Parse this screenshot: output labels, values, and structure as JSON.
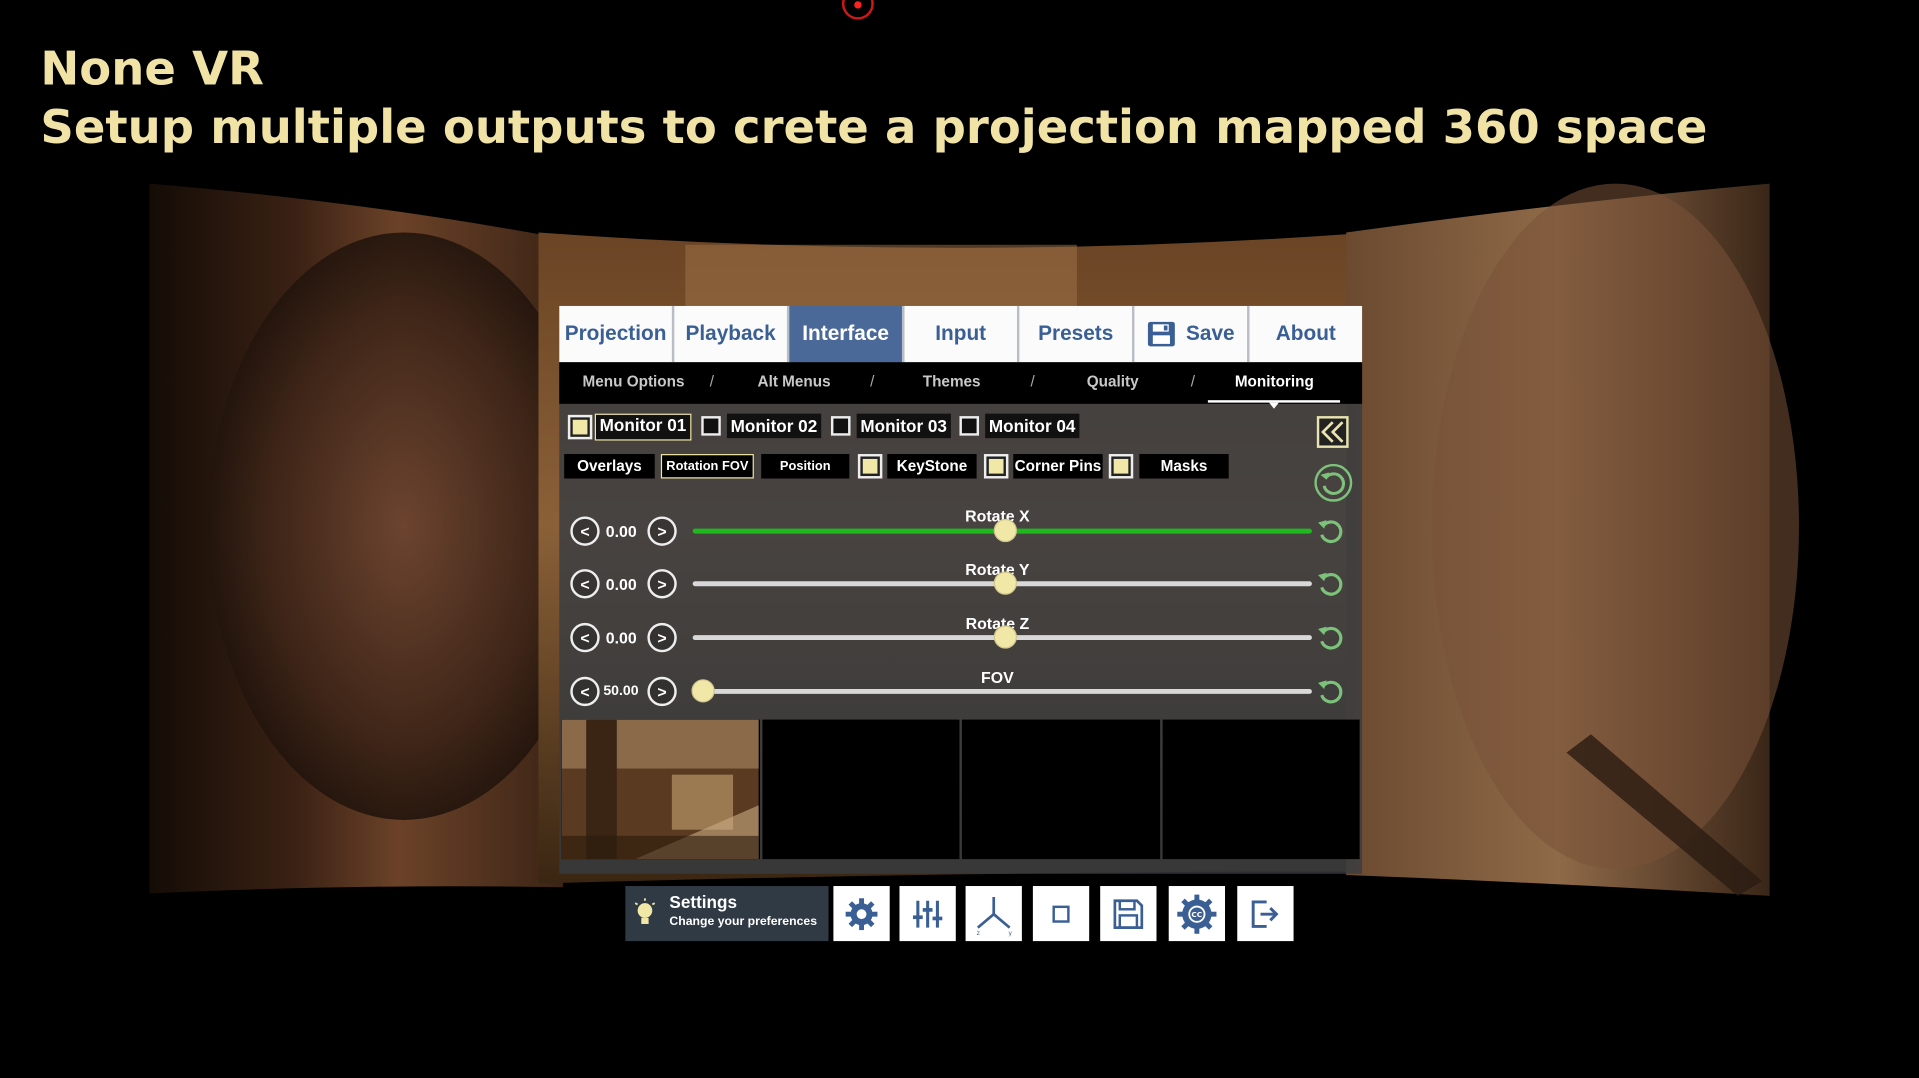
{
  "header": {
    "title": "None VR",
    "subtitle": "Setup multiple outputs to crete a projection mapped 360 space"
  },
  "tabs": [
    {
      "label": "Projection"
    },
    {
      "label": "Playback"
    },
    {
      "label": "Interface",
      "active": true
    },
    {
      "label": "Input"
    },
    {
      "label": "Presets"
    },
    {
      "label": "Save",
      "icon": "floppy-disk-icon"
    },
    {
      "label": "About"
    }
  ],
  "subnav": {
    "items": [
      "Menu Options",
      "Alt Menus",
      "Themes",
      "Quality",
      "Monitoring"
    ],
    "separator": "/",
    "active": "Monitoring"
  },
  "monitors": [
    {
      "label": "Monitor 01",
      "checked": true,
      "active": true
    },
    {
      "label": "Monitor 02",
      "checked": false
    },
    {
      "label": "Monitor 03",
      "checked": false
    },
    {
      "label": "Monitor 04",
      "checked": false
    }
  ],
  "subtabs": [
    {
      "label": "Overlays"
    },
    {
      "label": "Rotation FOV",
      "active": true
    },
    {
      "label": "Position"
    },
    {
      "label": "KeyStone",
      "checkbox": true
    },
    {
      "label": "Corner Pins",
      "checkbox": true
    },
    {
      "label": "Masks",
      "checkbox": true
    }
  ],
  "sliders": [
    {
      "label": "Rotate X",
      "value": "0.00",
      "position": 0.5,
      "active": true
    },
    {
      "label": "Rotate Y",
      "value": "0.00",
      "position": 0.5
    },
    {
      "label": "Rotate Z",
      "value": "0.00",
      "position": 0.5
    },
    {
      "label": "FOV",
      "value": "50.00",
      "position": 0.0
    }
  ],
  "controls": {
    "decrement": "<",
    "increment": ">"
  },
  "toolbar": {
    "settings_title": "Settings",
    "settings_subtitle": "Change your preferences",
    "buttons": [
      "gear-icon",
      "equalizer-icon",
      "axis-icon",
      "square-icon",
      "save-icon",
      "cc-gear-icon",
      "exit-icon"
    ]
  },
  "colors": {
    "accent_yellow": "#f1e7a7",
    "tab_active": "#4b6998",
    "tab_text": "#3a5f95",
    "slider_active": "#1fb81f",
    "reset_green": "#7cc27a"
  }
}
